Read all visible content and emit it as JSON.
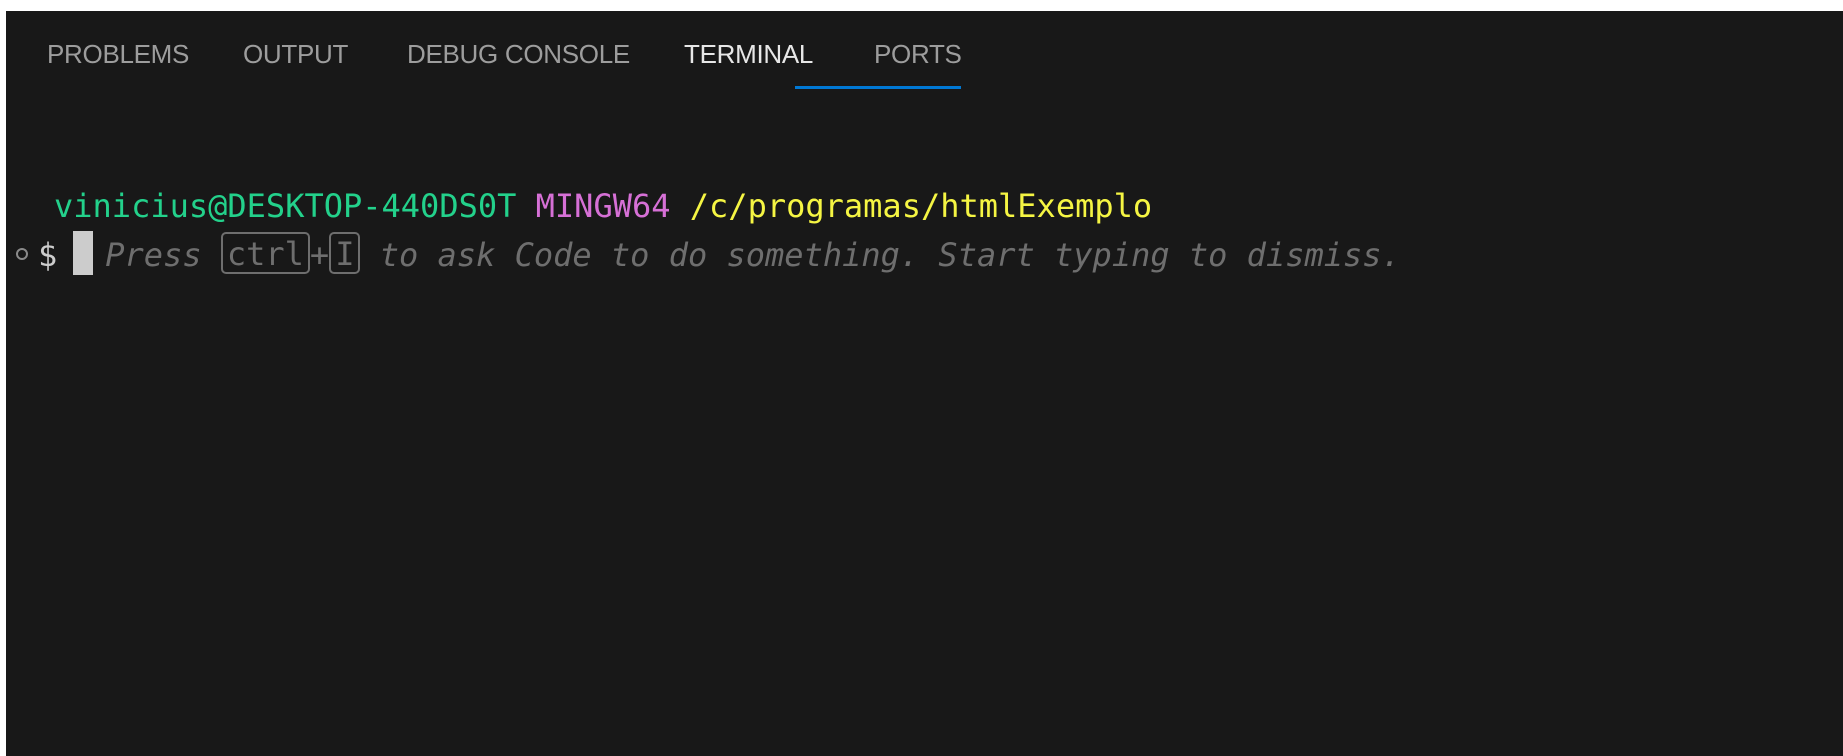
{
  "panel_tabs": [
    {
      "label": "PROBLEMS",
      "active": false
    },
    {
      "label": "OUTPUT",
      "active": false
    },
    {
      "label": "DEBUG CONSOLE",
      "active": false
    },
    {
      "label": "TERMINAL",
      "active": true
    },
    {
      "label": "PORTS",
      "active": false
    }
  ],
  "terminal": {
    "prompt_user": "vinicius@DESKTOP-440DS0T",
    "prompt_env": "MINGW64",
    "prompt_path": "/c/programas/htmlExemplo",
    "prompt_symbol": "$",
    "hint_press": "Press",
    "hint_key1": "ctrl",
    "hint_plus": "+",
    "hint_key2": "I",
    "hint_rest": "to ask Code to do something. Start typing to dismiss."
  },
  "colors": {
    "background": "#181818",
    "user": "#23d18b",
    "env": "#d670d6",
    "path": "#f5f543",
    "active_tab_underline": "#0078d4"
  }
}
